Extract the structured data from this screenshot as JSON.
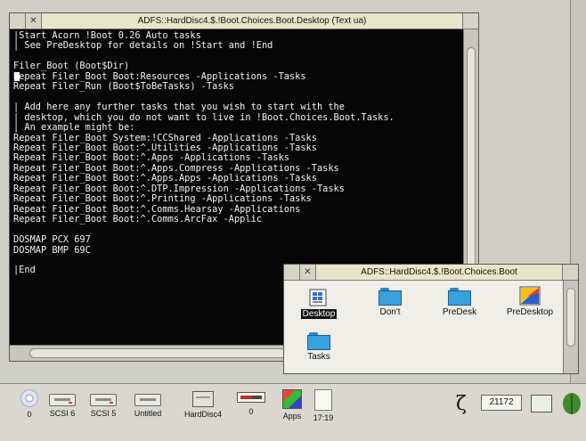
{
  "text_window": {
    "title": "ADFS::HardDisc4.$.!Boot.Choices.Boot.Desktop (Text ua)",
    "lines": [
      "|Start Acorn !Boot 0.26 Auto tasks",
      "| See PreDesktop for details on !Start and !End",
      "",
      "Filer_Boot (Boot$Dir)",
      "Repeat Filer_Boot Boot:Resources -Applications -Tasks",
      "Repeat Filer_Run (Boot$ToBeTasks) -Tasks",
      "",
      "| Add here any further tasks that you wish to start with the",
      "| desktop, which you do not want to live in !Boot.Choices.Boot.Tasks.",
      "| An example might be:",
      "Repeat Filer_Boot System:!CCShared -Applications -Tasks",
      "Repeat Filer_Boot Boot:^.Utilities -Applications -Tasks",
      "Repeat Filer_Boot Boot:^.Apps -Applications -Tasks",
      "Repeat Filer_Boot Boot:^.Apps.Compress -Applications -Tasks",
      "Repeat Filer_Boot Boot:^.Apps.Apps -Applications -Tasks",
      "Repeat Filer_Boot Boot:^.DTP.Impression -Applications -Tasks",
      "Repeat Filer_Boot Boot:^.Printing -Applications -Tasks",
      "Repeat Filer_Boot Boot:^.Comms.Hearsay -Applications",
      "Repeat Filer_Boot Boot:^.Comms.ArcFax -Applic",
      "",
      "DOSMAP PCX 697",
      "DOSMAP BMP 69C",
      "",
      "|End"
    ]
  },
  "filer_window": {
    "title": "ADFS::HardDisc4.$.!Boot.Choices.Boot",
    "items": [
      {
        "label": "Desktop",
        "icon": "desktop-file-icon",
        "selected": true
      },
      {
        "label": "Don't",
        "icon": "folder-icon"
      },
      {
        "label": "PreDesk",
        "icon": "folder-icon"
      },
      {
        "label": "PreDesktop",
        "icon": "predesktop-file-icon"
      },
      {
        "label": "Tasks",
        "icon": "folder-icon"
      }
    ]
  },
  "iconbar": {
    "cd": "0",
    "scsi6": "SCSI 6",
    "scsi5": "SCSI 5",
    "untitled": "Untitled",
    "harddisc": "HardDisc4",
    "ram": "0",
    "apps": "Apps",
    "clock": "17:19",
    "free": "21172"
  }
}
